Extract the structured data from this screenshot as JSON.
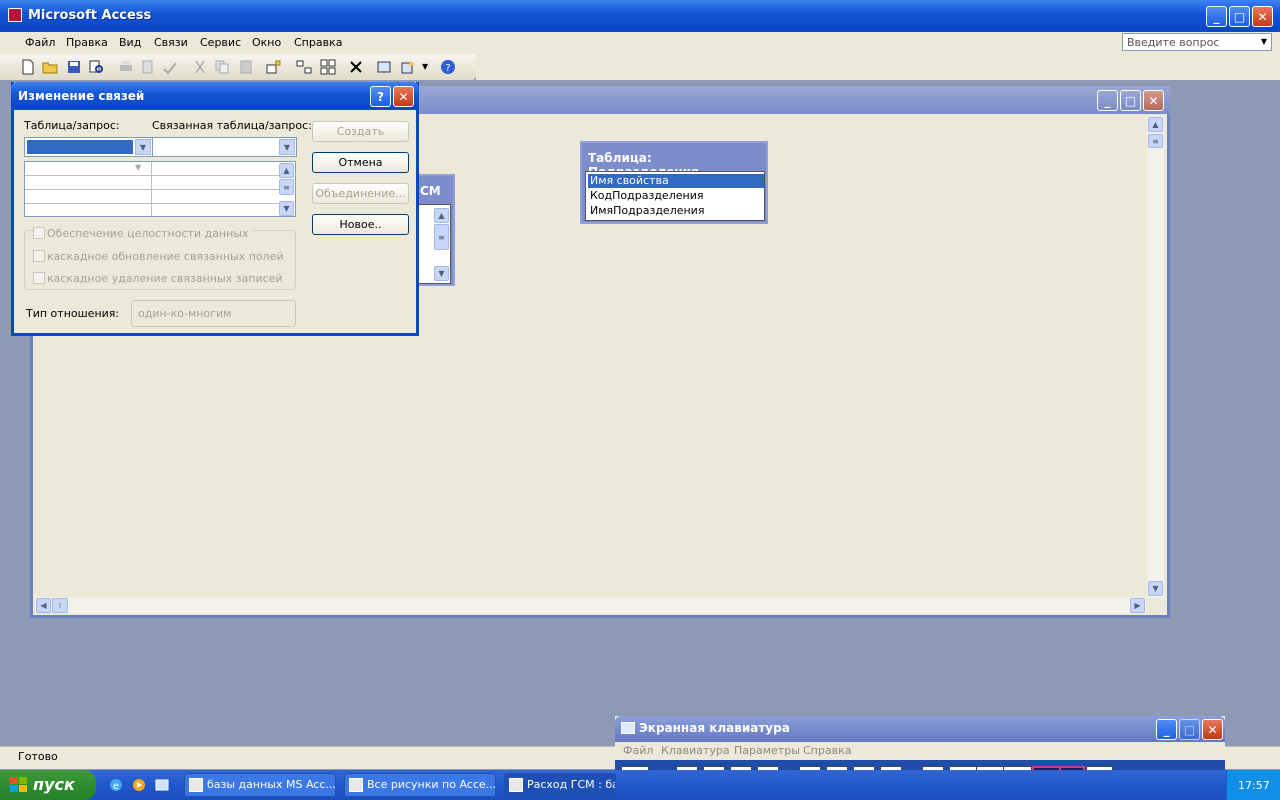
{
  "app": {
    "title": "Microsoft Access",
    "menu": [
      "Файл",
      "Правка",
      "Вид",
      "Связи",
      "Сервис",
      "Окно",
      "Справка"
    ],
    "help_placeholder": "Введите вопрос"
  },
  "tables": [
    {
      "title": "Таблица: Подразделения",
      "fields": [
        "Имя свойства",
        "КодПодразделения",
        "ИмяПодразделения"
      ],
      "selected_index": 0
    },
    {
      "title_fragment": "СМ"
    }
  ],
  "dialog": {
    "title": "Изменение связей",
    "help_glyph": "?",
    "close_glyph": "✕",
    "table_label": "Таблица/запрос:",
    "related_label": "Связанная таблица/запрос:",
    "buttons": {
      "create": "Создать",
      "cancel": "Отмена",
      "join": "Объединение...",
      "new": "Новое.."
    },
    "checks": [
      "Обеспечение целостности данных",
      "каскадное обновление связанных полей",
      "каскадное удаление связанных записей"
    ],
    "relation_type_label": "Тип отношения:",
    "relation_type_value": "один-ко-многим"
  },
  "status": "Готово",
  "osk": {
    "title": "Экранная клавиатура",
    "menu": [
      "Файл",
      "Клавиатура",
      "Параметры",
      "Справка"
    ],
    "keys": [
      "esc",
      "F1",
      "F2",
      "F3",
      "F4",
      "F5",
      "F6",
      "F7",
      "F8",
      "F9",
      "F10",
      "F11",
      "F12",
      "psc",
      "slk",
      "brk"
    ]
  },
  "taskbar": {
    "start": "пуск",
    "tasks": [
      "базы данных MS Acc...",
      "Все рисунки по Acce...",
      "Расход ГСМ : баз"
    ],
    "clock": "17:57"
  }
}
